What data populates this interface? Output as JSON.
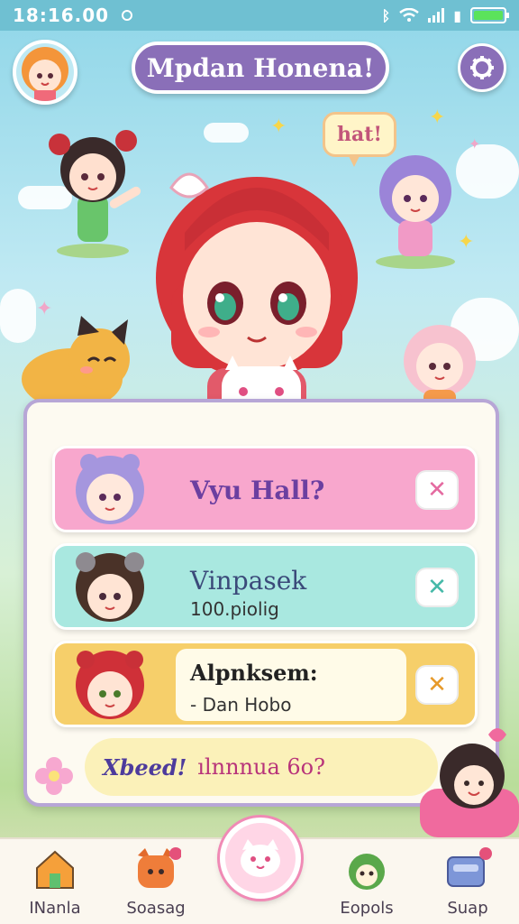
{
  "status_bar": {
    "time": "18:16.00",
    "battery_level": 1.0
  },
  "header": {
    "title": "Mpdan Honena!",
    "profile_icon": "avatar-icon",
    "settings_icon": "gear-icon"
  },
  "scene": {
    "speech_bubble": "hat!"
  },
  "card": {
    "rows": [
      {
        "label": "Vyu Hall?",
        "sub": "",
        "action_icon": "close-icon",
        "color": "#f8a7cd"
      },
      {
        "label": "Vinpasek",
        "sub": "100.piolig",
        "action_icon": "close-icon",
        "color": "#a9e8e0"
      },
      {
        "label": "Alpnksem:",
        "sub": "- Dan Hobo",
        "action_icon": "close-icon",
        "color": "#f6cf6a"
      }
    ],
    "bottom_pill": {
      "part1": "Xbeed!",
      "part2": "ılnnnua 6o?"
    }
  },
  "nav": {
    "items": [
      {
        "label": "INanla",
        "icon": "home-icon"
      },
      {
        "label": "Soasag",
        "icon": "fox-icon"
      },
      {
        "label": "Eopols",
        "icon": "frog-icon"
      },
      {
        "label": "Suap",
        "icon": "box-icon"
      }
    ],
    "center_icon": "cat-icon"
  },
  "colors": {
    "accent": "#8a6fb8",
    "pink": "#f8a7cd",
    "mint": "#a9e8e0",
    "yellow": "#f6cf6a"
  }
}
